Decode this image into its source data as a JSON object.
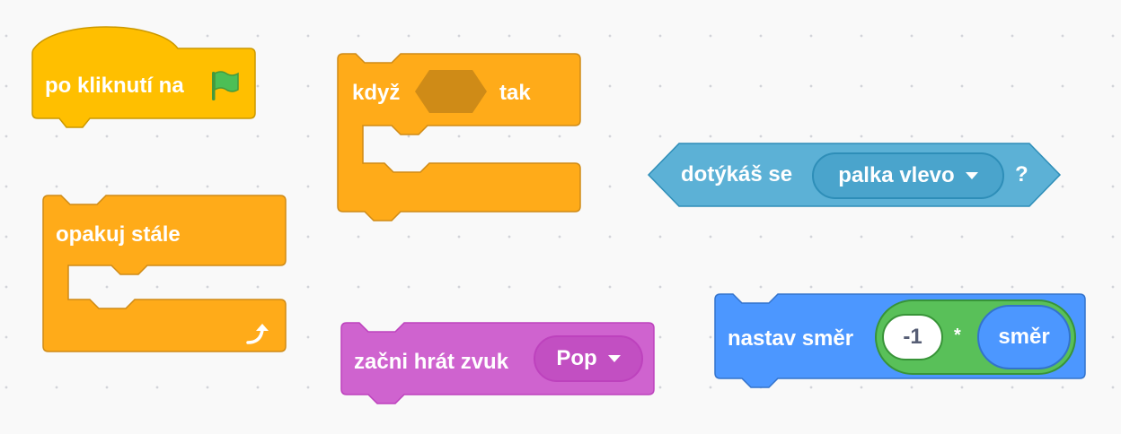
{
  "workspace": {
    "when_flag": {
      "label": "po kliknutí na",
      "icon": "green-flag-icon",
      "color": "#FFBF00"
    },
    "forever": {
      "label": "opakuj stále",
      "icon": "loop-arrow-icon",
      "color": "#FFAB19"
    },
    "if_then": {
      "label_if": "když",
      "label_then": "tak",
      "color": "#FFAB19",
      "slot_color": "#CF8B17"
    },
    "touching": {
      "label": "dotýkáš se",
      "menu_value": "palka vlevo",
      "suffix": "?",
      "color": "#5CB1D6",
      "menu_color": "#2E8EB8"
    },
    "play_sound": {
      "label": "začni hrát zvuk",
      "menu_value": "Pop",
      "color": "#CF63CF",
      "menu_color": "#BD42BD"
    },
    "set_direction": {
      "label": "nastav směr",
      "number_value": "-1",
      "operator": "*",
      "reporter_label": "směr",
      "color": "#4C97FF",
      "operator_color": "#59C059",
      "reporter_color": "#4C97FF"
    }
  }
}
